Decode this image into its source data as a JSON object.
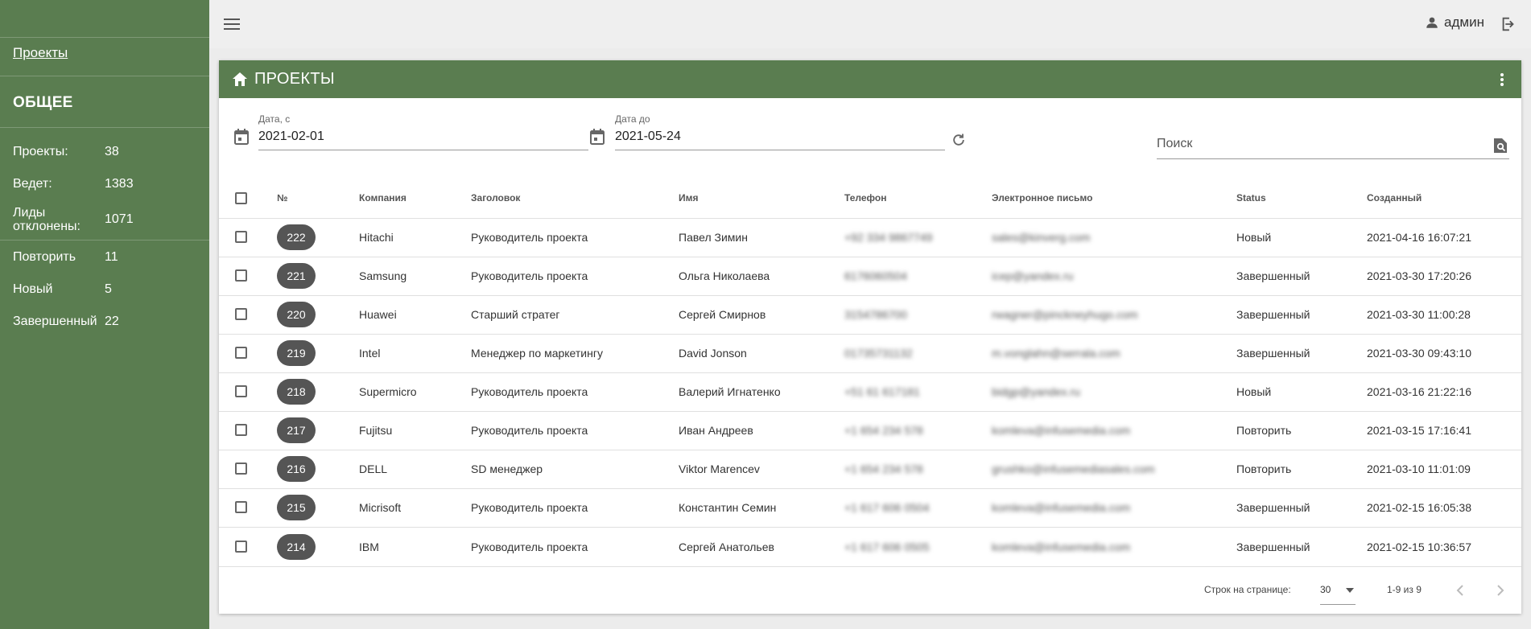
{
  "sidebar": {
    "link": "Проекты",
    "section_title": "ОБЩЕЕ",
    "stats": [
      {
        "label": "Проекты:",
        "value": "38"
      },
      {
        "label": "Ведет:",
        "value": "1383"
      },
      {
        "label": "Лиды отклонены:",
        "value": "1071"
      },
      {
        "label": "Повторить",
        "value": "11"
      },
      {
        "label": "Новый",
        "value": "5"
      },
      {
        "label": "Завершенный",
        "value": "22"
      }
    ]
  },
  "topbar": {
    "menu_icon": "menu-icon",
    "user_icon": "person-icon",
    "username": "админ",
    "logout_icon": "logout-icon"
  },
  "card": {
    "title": "ПРОЕКТЫ",
    "home_icon": "home-icon",
    "more_icon": "more-vert-icon"
  },
  "filters": {
    "date_from": {
      "label": "Дата, с",
      "value": "2021-02-01"
    },
    "date_to": {
      "label": "Дата до",
      "value": "2021-05-24"
    },
    "search_placeholder": "Поиск"
  },
  "table": {
    "columns": [
      "№",
      "Компания",
      "Заголовок",
      "Имя",
      "Телефон",
      "Электронное письмо",
      "Status",
      "Созданный"
    ],
    "rows": [
      {
        "id": "222",
        "company": "Hitachi",
        "title": "Руководитель проекта",
        "name": "Павел Зимин",
        "phone": "+92 334 9867749",
        "email": "sales@kinverg.com",
        "status": "Новый",
        "created": "2021-04-16 16:07:21"
      },
      {
        "id": "221",
        "company": "Samsung",
        "title": "Руководитель проекта",
        "name": "Ольга Николаева",
        "phone": "6176060504",
        "email": "icep@yandex.ru",
        "status": "Завершенный",
        "created": "2021-03-30 17:20:26"
      },
      {
        "id": "220",
        "company": "Huawei",
        "title": "Старший стратег",
        "name": "Сергей Смирнов",
        "phone": "3154786700",
        "email": "rwagner@pinckneyhugo.com",
        "status": "Завершенный",
        "created": "2021-03-30 11:00:28"
      },
      {
        "id": "219",
        "company": "Intel",
        "title": "Менеджер по маркетингу",
        "name": "David Jonson",
        "phone": "01735731132",
        "email": "m.vonglahn@serrala.com",
        "status": "Завершенный",
        "created": "2021-03-30 09:43:10"
      },
      {
        "id": "218",
        "company": "Supermicro",
        "title": "Руководитель проекта",
        "name": "Валерий Игнатенко",
        "phone": "+51 61 617181",
        "email": "bidgp@yandex.ru",
        "status": "Новый",
        "created": "2021-03-16 21:22:16"
      },
      {
        "id": "217",
        "company": "Fujitsu",
        "title": "Руководитель проекта",
        "name": "Иван Андреев",
        "phone": "+1 654 234 578",
        "email": "komleva@infusemedia.com",
        "status": "Повторить",
        "created": "2021-03-15 17:16:41"
      },
      {
        "id": "216",
        "company": "DELL",
        "title": "SD менеджер",
        "name": "Viktor Marencev",
        "phone": "+1 654 234 578",
        "email": "grushko@infusemediasales.com",
        "status": "Повторить",
        "created": "2021-03-10 11:01:09"
      },
      {
        "id": "215",
        "company": "Micrisoft",
        "title": "Руководитель проекта",
        "name": "Константин Семин",
        "phone": "+1 617 606 0504",
        "email": "komleva@infusemedia.com",
        "status": "Завершенный",
        "created": "2021-02-15 16:05:38"
      },
      {
        "id": "214",
        "company": "IBM",
        "title": "Руководитель проекта",
        "name": "Сергей Анатольев",
        "phone": "+1 617 606 0505",
        "email": "komleva@infusemedia.com",
        "status": "Завершенный",
        "created": "2021-02-15 10:36:57"
      }
    ]
  },
  "pagination": {
    "rows_per_page_label": "Строк на странице:",
    "rows_per_page": "30",
    "range": "1-9 из 9"
  },
  "colors": {
    "accent": "#5a7d50",
    "badge": "#555555"
  }
}
